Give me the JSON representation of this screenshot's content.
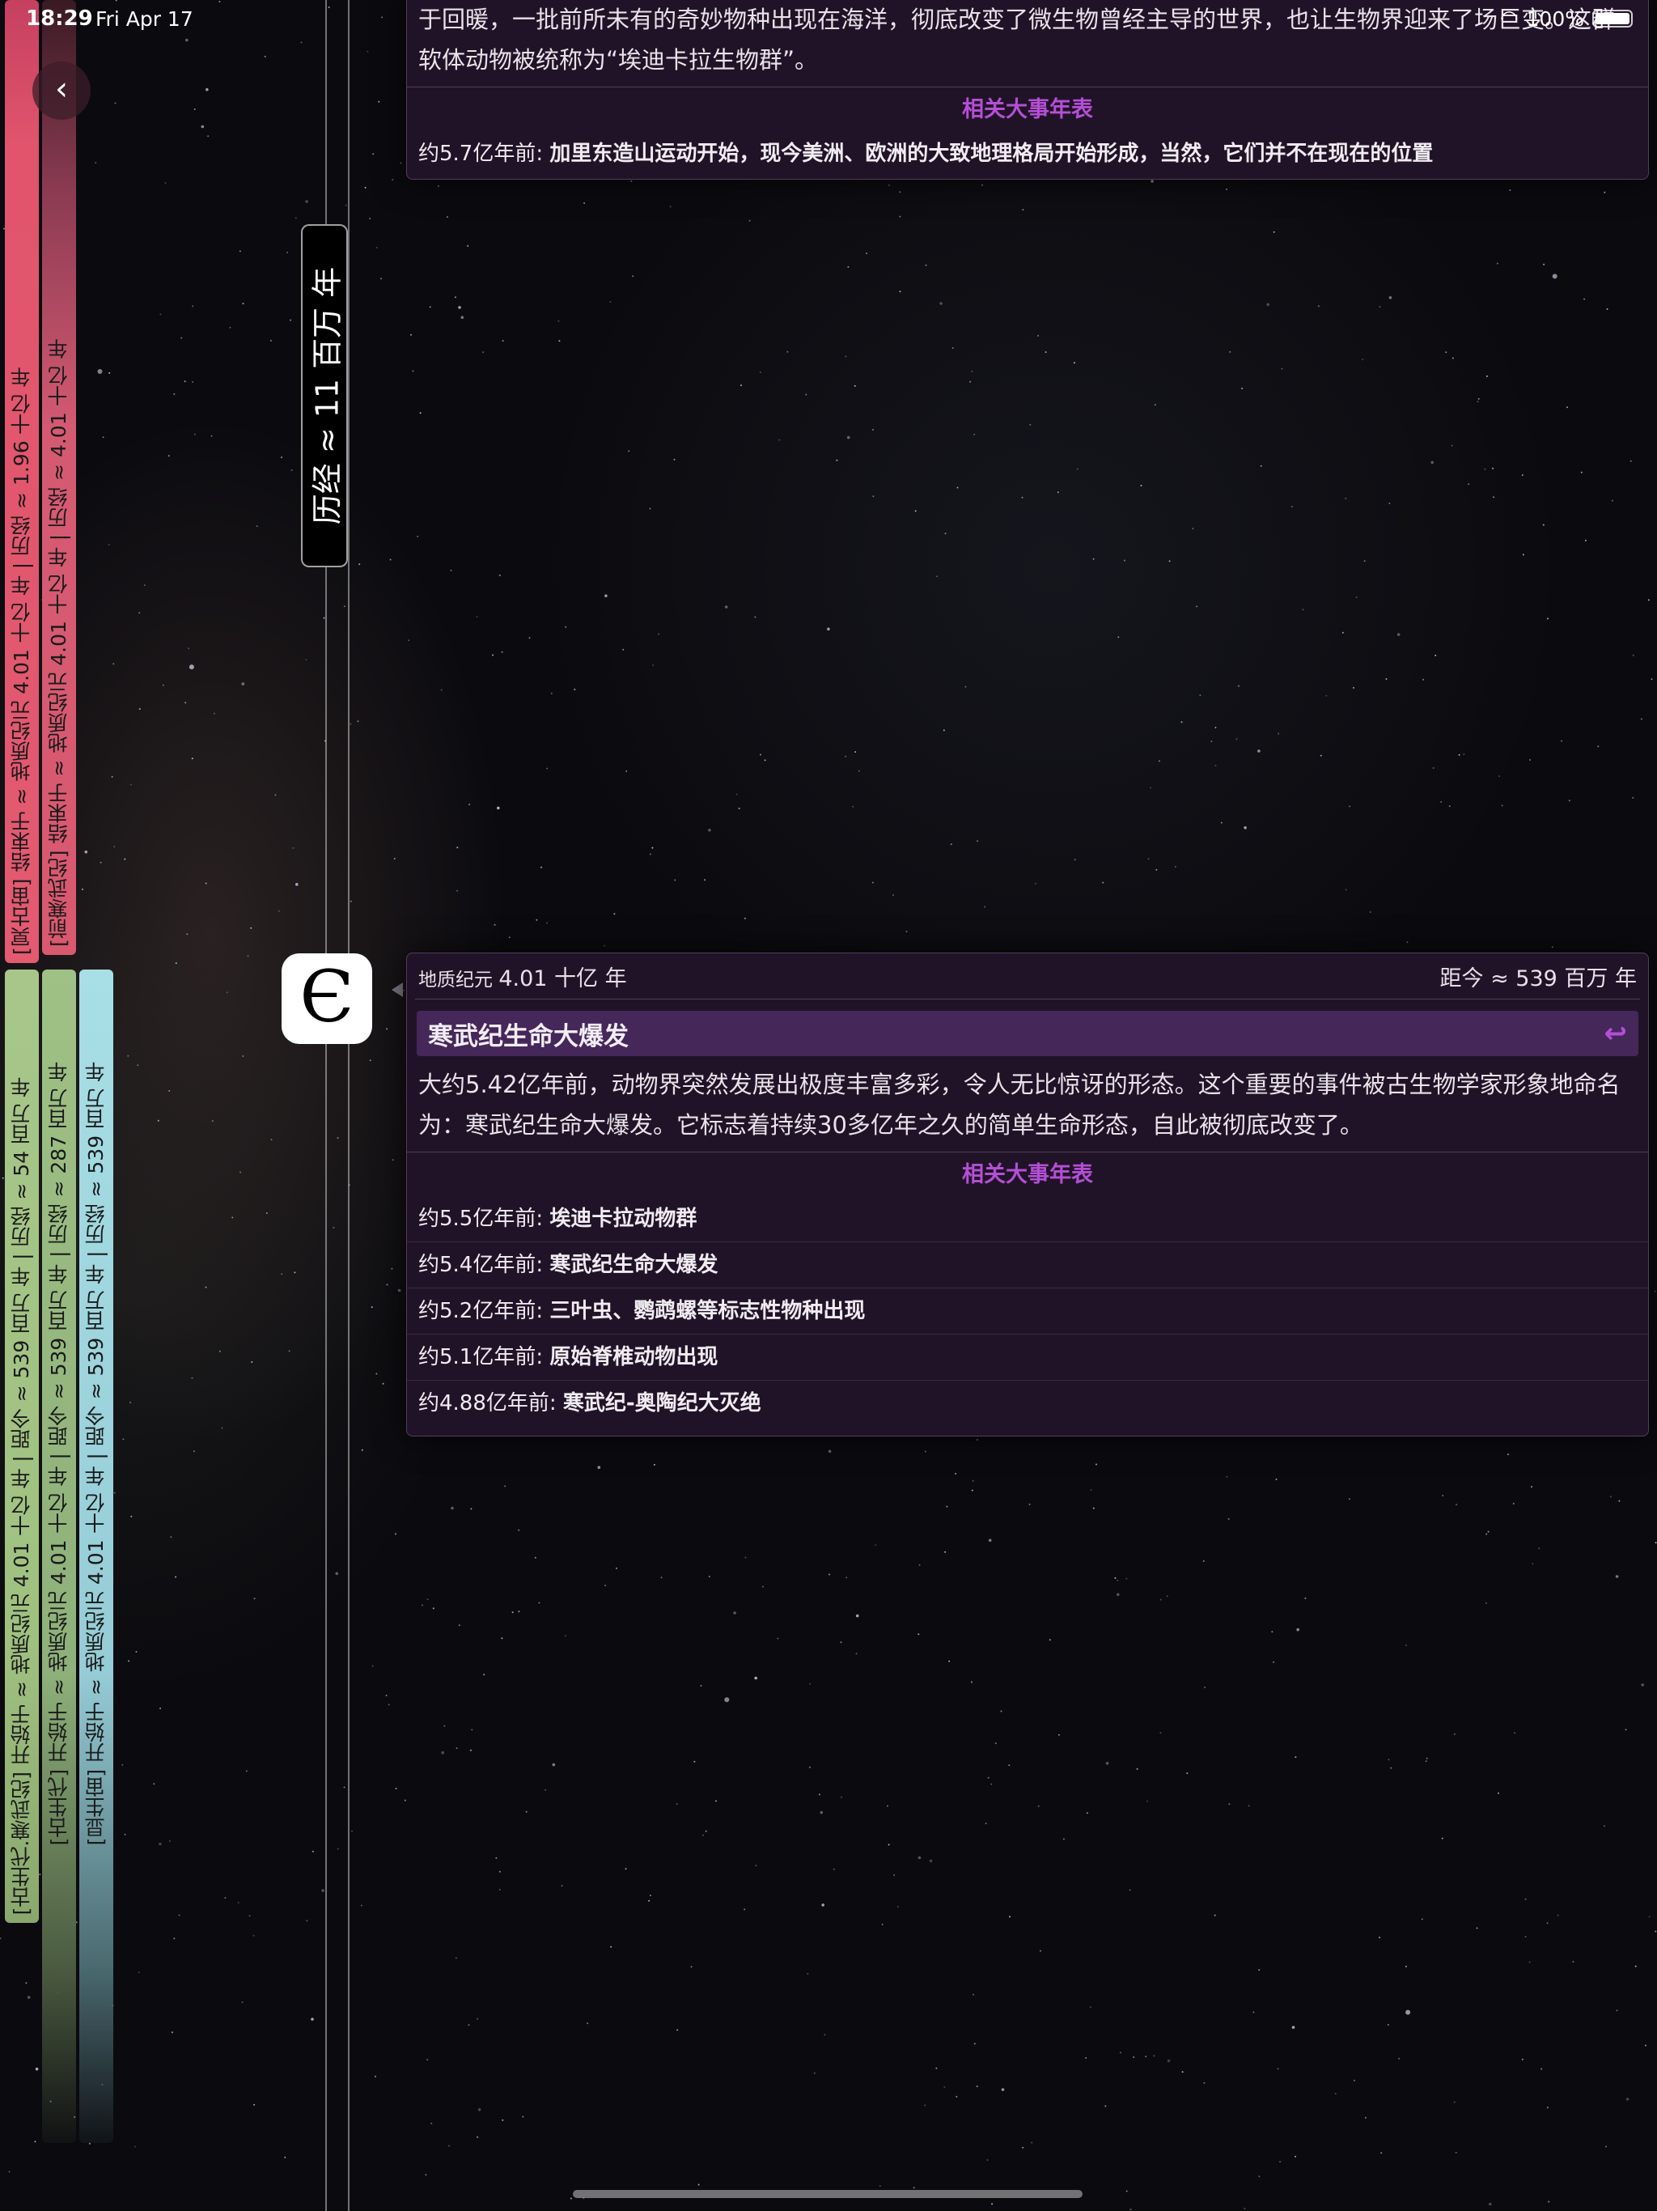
{
  "status_bar": {
    "time": "18:29",
    "date": "Fri Apr 17",
    "battery": "100%"
  },
  "timeline": {
    "bars": [
      {
        "label": "[冥古宙] 结束于 ≈ 地质纪元 4.01 十亿 年 | 历经 ≈ 1.96 十亿 年",
        "color": "#e35a71"
      },
      {
        "label": "[前寒武纪] 结束于 ≈ 地质纪元 4.01 十亿 年 | 历经 ≈ 4.01 十亿 年",
        "color": "#d9596f"
      },
      {
        "label": "[古生代.寒武纪] 开始于 ≈ 地质纪元 4.01 十亿 年 | 距今 ≈ 539 百万 年 | 历经 ≈ 54 百万 年",
        "color": "#a8c68a"
      },
      {
        "label": "[古生代] 开始于 ≈ 地质纪元 4.01 十亿 年 | 距今 ≈ 539 百万 年 | 历经 ≈ 287 百万 年",
        "color": "#9fc185"
      },
      {
        "label": "[显生宙] 开始于 ≈ 地质纪元 4.01 十亿 年 | 距今 ≈ 539 百万 年 | 历经 ≈ 539 百万 年",
        "color": "#a8dfe6"
      }
    ],
    "span_label": "历经 ≈ 11 百万 年",
    "era_symbol": "Є"
  },
  "top_card": {
    "description": "于回暖，一批前所未有的奇妙物种出现在海洋，彻底改变了微生物曾经主导的世界，也让生物界迎来了场巨变。这群软体动物被统称为“埃迪卡拉生物群”。",
    "section_title": "相关大事年表",
    "events": [
      {
        "time": "约5.7亿年前:",
        "text": "加里东造山运动开始，现今美洲、欧洲的大致地理格局开始形成，当然，它们并不在现在的位置"
      }
    ]
  },
  "main_card": {
    "epoch_prefix": "地质纪元",
    "epoch_value": "4.01 十亿 年",
    "distance": "距今 ≈ 539 百万 年",
    "title": "寒武纪生命大爆发",
    "description": "大约5.42亿年前，动物界突然发展出极度丰富多彩，令人无比惊讶的形态。这个重要的事件被古生物学家形象地命名为：寒武纪生命大爆发。它标志着持续30多亿年之久的简单生命形态，自此被彻底改变了。",
    "section_title": "相关大事年表",
    "events": [
      {
        "time": "约5.5亿年前:",
        "text": "埃迪卡拉动物群"
      },
      {
        "time": "约5.4亿年前:",
        "text": "寒武纪生命大爆发"
      },
      {
        "time": "约5.2亿年前:",
        "text": "三叶虫、鹦鹉螺等标志性物种出现"
      },
      {
        "time": "约5.1亿年前:",
        "text": "原始脊椎动物出现"
      },
      {
        "time": "约4.88亿年前:",
        "text": "寒武纪-奥陶纪大灭绝"
      }
    ]
  },
  "icons": {
    "back": "chevron-left-icon",
    "return": "return-icon",
    "wifi": "wifi-icon",
    "battery": "battery-icon"
  },
  "colors": {
    "accent": "#b44fd6",
    "card_bg": "#211327",
    "title_bar_bg": "#45275a"
  }
}
